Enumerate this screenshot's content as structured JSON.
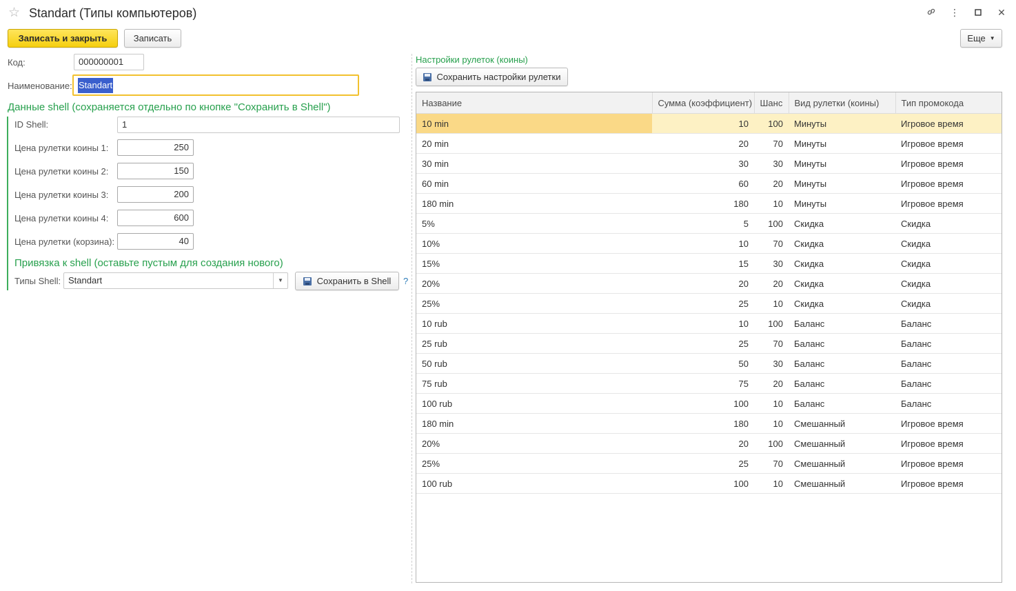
{
  "window": {
    "title": "Standart (Типы компьютеров)"
  },
  "toolbar": {
    "save_close": "Записать и закрыть",
    "save": "Записать",
    "more": "Еще"
  },
  "form": {
    "code_label": "Код:",
    "code_value": "000000001",
    "name_label": "Наименование:",
    "name_value": "Standart",
    "shell_section_title": "Данные shell (сохраняется отдельно по кнопке \"Сохранить в Shell\")",
    "id_shell_label": "ID Shell:",
    "id_shell_value": "1",
    "prices": [
      {
        "label": "Цена рулетки коины 1:",
        "value": "250"
      },
      {
        "label": "Цена рулетки коины 2:",
        "value": "150"
      },
      {
        "label": "Цена рулетки коины 3:",
        "value": "200"
      },
      {
        "label": "Цена рулетки коины 4:",
        "value": "600"
      },
      {
        "label": "Цена рулетки (корзина):",
        "value": "40"
      }
    ],
    "binding_title": "Привязка к shell (оставьте пустым для создания нового)",
    "shell_types_label": "Типы Shell:",
    "shell_types_value": "Standart",
    "save_shell_button": "Сохранить в Shell",
    "help": "?"
  },
  "roulette": {
    "section_title": "Настройки рулеток (коины)",
    "save_button": "Сохранить настройки рулетки",
    "columns": [
      "Название",
      "Сумма (коэффициент)",
      "Шанс",
      "Вид рулетки (коины)",
      "Тип промокода"
    ],
    "rows": [
      [
        "10 min",
        "10",
        "100",
        "Минуты",
        "Игровое время"
      ],
      [
        "20 min",
        "20",
        "70",
        "Минуты",
        "Игровое время"
      ],
      [
        "30 min",
        "30",
        "30",
        "Минуты",
        "Игровое время"
      ],
      [
        "60 min",
        "60",
        "20",
        "Минуты",
        "Игровое время"
      ],
      [
        "180 min",
        "180",
        "10",
        "Минуты",
        "Игровое время"
      ],
      [
        "5%",
        "5",
        "100",
        "Скидка",
        "Скидка"
      ],
      [
        "10%",
        "10",
        "70",
        "Скидка",
        "Скидка"
      ],
      [
        "15%",
        "15",
        "30",
        "Скидка",
        "Скидка"
      ],
      [
        "20%",
        "20",
        "20",
        "Скидка",
        "Скидка"
      ],
      [
        "25%",
        "25",
        "10",
        "Скидка",
        "Скидка"
      ],
      [
        "10 rub",
        "10",
        "100",
        "Баланс",
        "Баланс"
      ],
      [
        "25 rub",
        "25",
        "70",
        "Баланс",
        "Баланс"
      ],
      [
        "50 rub",
        "50",
        "30",
        "Баланс",
        "Баланс"
      ],
      [
        "75 rub",
        "75",
        "20",
        "Баланс",
        "Баланс"
      ],
      [
        "100 rub",
        "100",
        "10",
        "Баланс",
        "Баланс"
      ],
      [
        "180 min",
        "180",
        "10",
        "Смешанный",
        "Игровое время"
      ],
      [
        "20%",
        "20",
        "100",
        "Смешанный",
        "Игровое время"
      ],
      [
        "25%",
        "25",
        "70",
        "Смешанный",
        "Игровое время"
      ],
      [
        "100 rub",
        "100",
        "10",
        "Смешанный",
        "Игровое время"
      ]
    ]
  }
}
